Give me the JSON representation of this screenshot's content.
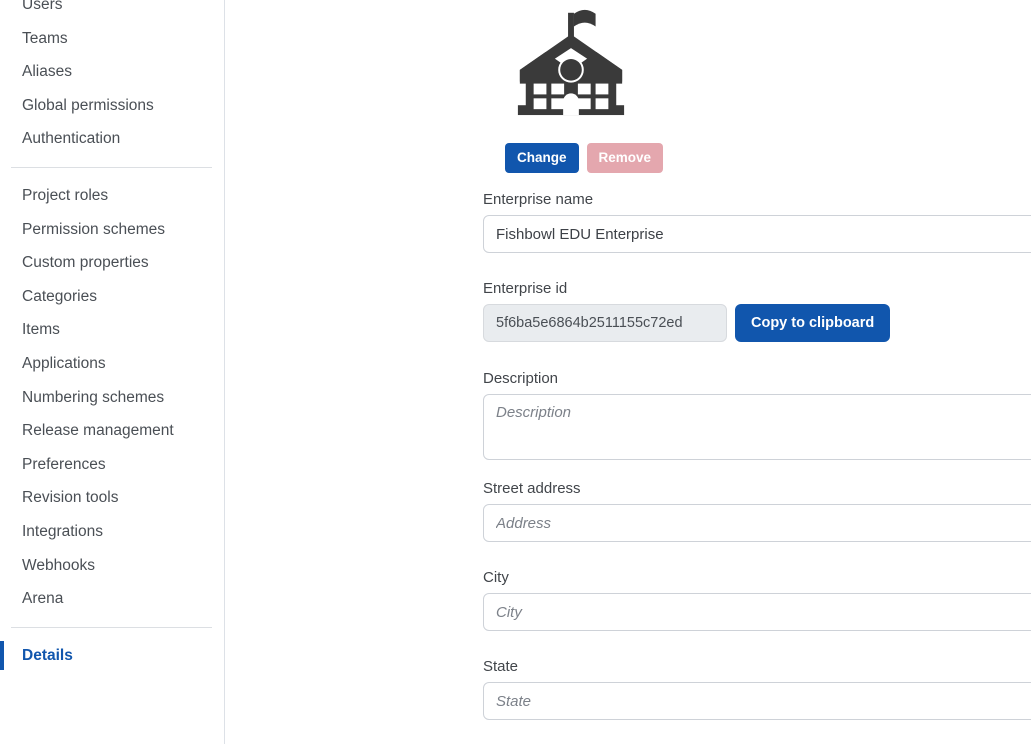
{
  "sidebar": {
    "groups": [
      {
        "name": "administration",
        "items": [
          {
            "label": "Users"
          },
          {
            "label": "Teams"
          },
          {
            "label": "Aliases"
          },
          {
            "label": "Global permissions"
          },
          {
            "label": "Authentication"
          }
        ]
      },
      {
        "name": "configuration",
        "items": [
          {
            "label": "Project roles"
          },
          {
            "label": "Permission schemes"
          },
          {
            "label": "Custom properties"
          },
          {
            "label": "Categories"
          },
          {
            "label": "Items"
          },
          {
            "label": "Applications"
          },
          {
            "label": "Numbering schemes"
          },
          {
            "label": "Release management"
          },
          {
            "label": "Preferences"
          },
          {
            "label": "Revision tools"
          },
          {
            "label": "Integrations"
          },
          {
            "label": "Webhooks"
          },
          {
            "label": "Arena"
          }
        ]
      },
      {
        "name": "enterprise",
        "items": [
          {
            "label": "Details"
          }
        ]
      }
    ]
  },
  "main": {
    "logo": {
      "icon": "school-building-icon",
      "change_label": "Change",
      "remove_label": "Remove"
    },
    "fields": {
      "enterprise_name": {
        "label": "Enterprise name",
        "value": "Fishbowl EDU Enterprise",
        "placeholder": ""
      },
      "enterprise_id": {
        "label": "Enterprise id",
        "value": "5f6ba5e6864b2511155c72ed",
        "copy_label": "Copy to clipboard"
      },
      "description": {
        "label": "Description",
        "value": "",
        "placeholder": "Description"
      },
      "street_address": {
        "label": "Street address",
        "value": "",
        "placeholder": "Address"
      },
      "city": {
        "label": "City",
        "value": "",
        "placeholder": "City"
      },
      "state": {
        "label": "State",
        "value": "",
        "placeholder": "State"
      }
    }
  },
  "colors": {
    "accent": "#1156ad",
    "danger_disabled": "#e4a7ae",
    "text": "#4a4f55",
    "border": "#ced2d8"
  }
}
